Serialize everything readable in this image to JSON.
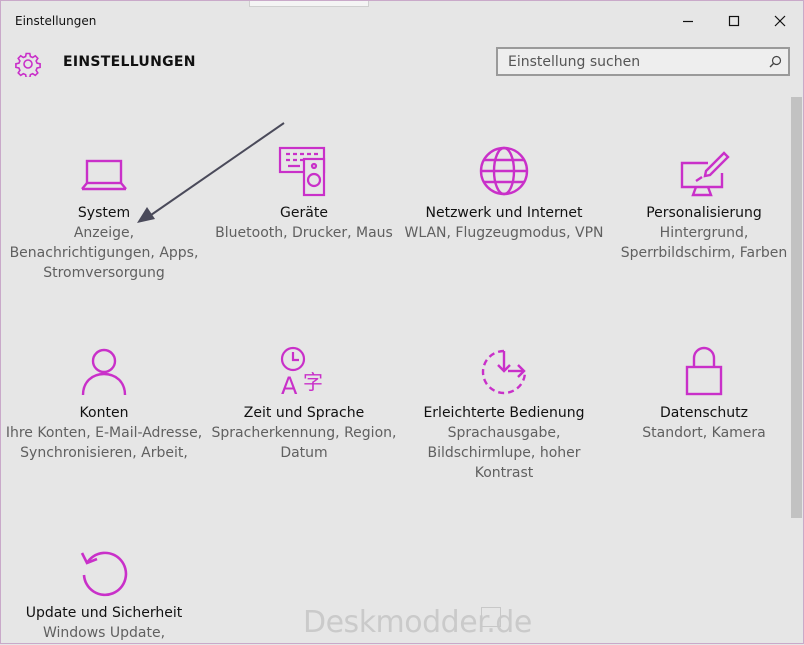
{
  "window": {
    "title": "Einstellungen"
  },
  "header": {
    "title": "EINSTELLUNGEN"
  },
  "search": {
    "placeholder": "Einstellung suchen"
  },
  "colors": {
    "accent": "#c930c9"
  },
  "tiles": [
    {
      "icon": "laptop-icon",
      "name": "System",
      "desc": "Anzeige, Benachrichtigungen, Apps, Stromversorgung"
    },
    {
      "icon": "devices-icon",
      "name": "Geräte",
      "desc": "Bluetooth, Drucker, Maus"
    },
    {
      "icon": "globe-icon",
      "name": "Netzwerk und Internet",
      "desc": "WLAN, Flugzeugmodus, VPN"
    },
    {
      "icon": "personalize-icon",
      "name": "Personalisierung",
      "desc": "Hintergrund, Sperrbildschirm, Farben"
    },
    {
      "icon": "person-icon",
      "name": "Konten",
      "desc": "Ihre Konten, E-Mail-Adresse, Synchronisieren, Arbeit,"
    },
    {
      "icon": "time-language-icon",
      "name": "Zeit und Sprache",
      "desc": "Spracherkennung, Region, Datum"
    },
    {
      "icon": "ease-of-access-icon",
      "name": "Erleichterte Bedienung",
      "desc": "Sprachausgabe, Bildschirmlupe, hoher Kontrast"
    },
    {
      "icon": "lock-icon",
      "name": "Datenschutz",
      "desc": "Standort, Kamera"
    },
    {
      "icon": "update-icon",
      "name": "Update und Sicherheit",
      "desc": "Windows Update,"
    }
  ],
  "watermark": "Deskmodder.de"
}
